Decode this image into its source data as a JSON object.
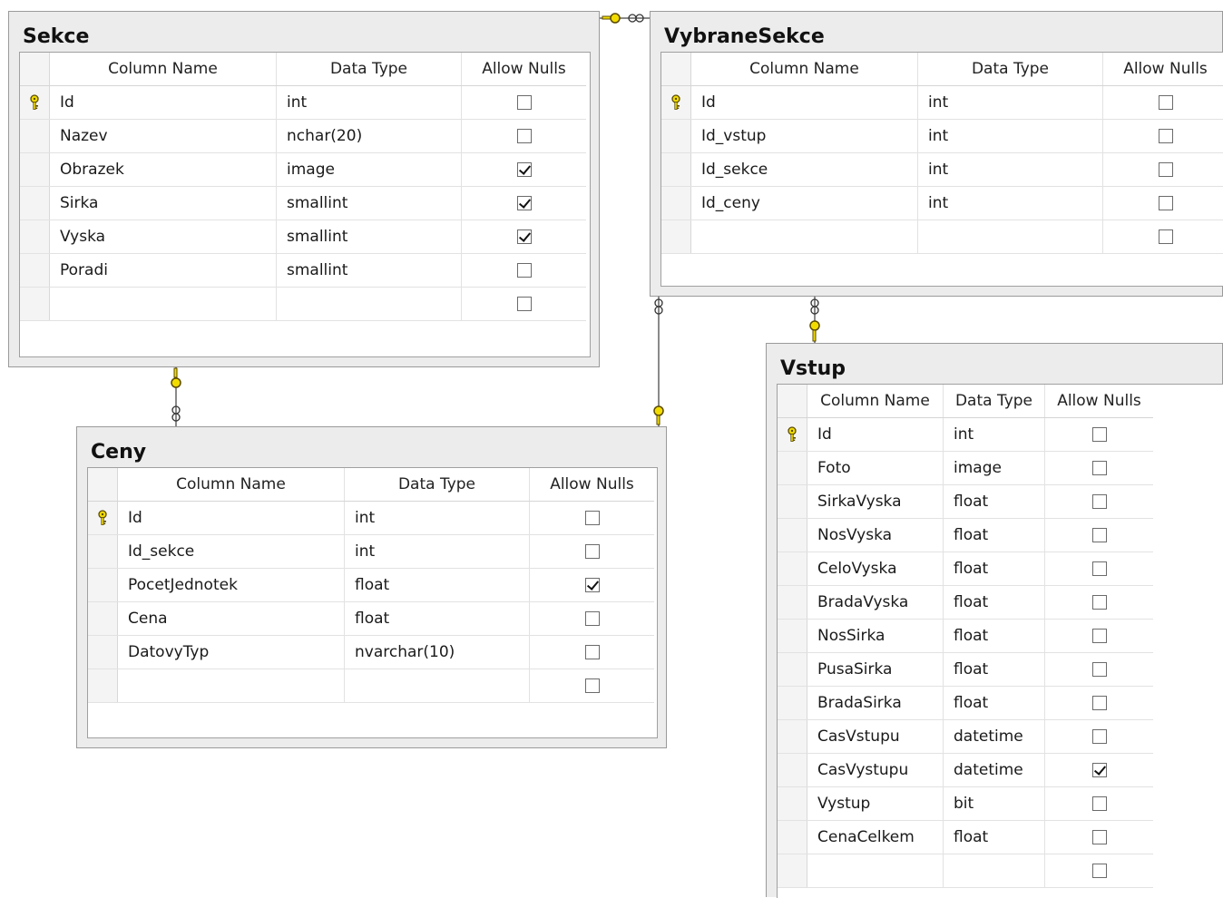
{
  "headers": {
    "column_name": "Column Name",
    "data_type": "Data Type",
    "allow_nulls": "Allow Nulls"
  },
  "tables": {
    "sekce": {
      "title": "Sekce",
      "rows": [
        {
          "name": "Id",
          "type": "int",
          "nulls": false,
          "pk": true
        },
        {
          "name": "Nazev",
          "type": "nchar(20)",
          "nulls": false
        },
        {
          "name": "Obrazek",
          "type": "image",
          "nulls": true
        },
        {
          "name": "Sirka",
          "type": "smallint",
          "nulls": true
        },
        {
          "name": "Vyska",
          "type": "smallint",
          "nulls": true
        },
        {
          "name": "Poradi",
          "type": "smallint",
          "nulls": false
        },
        {
          "name": "",
          "type": "",
          "nulls": false
        }
      ]
    },
    "vybraneSekce": {
      "title": "VybraneSekce",
      "rows": [
        {
          "name": "Id",
          "type": "int",
          "nulls": false,
          "pk": true
        },
        {
          "name": "Id_vstup",
          "type": "int",
          "nulls": false
        },
        {
          "name": "Id_sekce",
          "type": "int",
          "nulls": false
        },
        {
          "name": "Id_ceny",
          "type": "int",
          "nulls": false
        },
        {
          "name": "",
          "type": "",
          "nulls": false
        }
      ]
    },
    "ceny": {
      "title": "Ceny",
      "rows": [
        {
          "name": "Id",
          "type": "int",
          "nulls": false,
          "pk": true
        },
        {
          "name": "Id_sekce",
          "type": "int",
          "nulls": false
        },
        {
          "name": "PocetJednotek",
          "type": "float",
          "nulls": true
        },
        {
          "name": "Cena",
          "type": "float",
          "nulls": false
        },
        {
          "name": "DatovyTyp",
          "type": "nvarchar(10)",
          "nulls": false
        },
        {
          "name": "",
          "type": "",
          "nulls": false
        }
      ]
    },
    "vstup": {
      "title": "Vstup",
      "rows": [
        {
          "name": "Id",
          "type": "int",
          "nulls": false,
          "pk": true
        },
        {
          "name": "Foto",
          "type": "image",
          "nulls": false
        },
        {
          "name": "SirkaVyska",
          "type": "float",
          "nulls": false
        },
        {
          "name": "NosVyska",
          "type": "float",
          "nulls": false
        },
        {
          "name": "CeloVyska",
          "type": "float",
          "nulls": false
        },
        {
          "name": "BradaVyska",
          "type": "float",
          "nulls": false
        },
        {
          "name": "NosSirka",
          "type": "float",
          "nulls": false
        },
        {
          "name": "PusaSirka",
          "type": "float",
          "nulls": false
        },
        {
          "name": "BradaSirka",
          "type": "float",
          "nulls": false
        },
        {
          "name": "CasVstupu",
          "type": "datetime",
          "nulls": false
        },
        {
          "name": "CasVystupu",
          "type": "datetime",
          "nulls": true
        },
        {
          "name": "Vystup",
          "type": "bit",
          "nulls": false
        },
        {
          "name": "CenaCelkem",
          "type": "float",
          "nulls": false
        },
        {
          "name": "",
          "type": "",
          "nulls": false
        }
      ]
    }
  },
  "icons": {
    "primary_key": "key-icon",
    "relation_one": "key-icon",
    "relation_many": "infinity-icon"
  },
  "colors": {
    "key": "#f2dc00",
    "key_outline": "#5a4a00",
    "connector": "#8a8a8a"
  }
}
